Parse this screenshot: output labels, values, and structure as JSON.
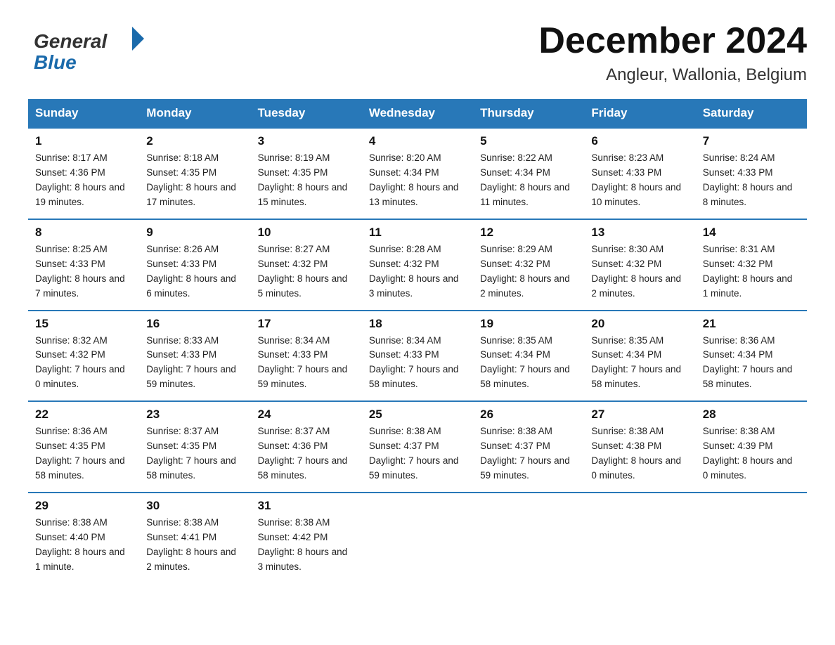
{
  "header": {
    "month_title": "December 2024",
    "location": "Angleur, Wallonia, Belgium",
    "logo_general": "General",
    "logo_blue": "Blue"
  },
  "weekdays": [
    "Sunday",
    "Monday",
    "Tuesday",
    "Wednesday",
    "Thursday",
    "Friday",
    "Saturday"
  ],
  "weeks": [
    [
      {
        "day": "1",
        "sunrise": "8:17 AM",
        "sunset": "4:36 PM",
        "daylight": "8 hours and 19 minutes."
      },
      {
        "day": "2",
        "sunrise": "8:18 AM",
        "sunset": "4:35 PM",
        "daylight": "8 hours and 17 minutes."
      },
      {
        "day": "3",
        "sunrise": "8:19 AM",
        "sunset": "4:35 PM",
        "daylight": "8 hours and 15 minutes."
      },
      {
        "day": "4",
        "sunrise": "8:20 AM",
        "sunset": "4:34 PM",
        "daylight": "8 hours and 13 minutes."
      },
      {
        "day": "5",
        "sunrise": "8:22 AM",
        "sunset": "4:34 PM",
        "daylight": "8 hours and 11 minutes."
      },
      {
        "day": "6",
        "sunrise": "8:23 AM",
        "sunset": "4:33 PM",
        "daylight": "8 hours and 10 minutes."
      },
      {
        "day": "7",
        "sunrise": "8:24 AM",
        "sunset": "4:33 PM",
        "daylight": "8 hours and 8 minutes."
      }
    ],
    [
      {
        "day": "8",
        "sunrise": "8:25 AM",
        "sunset": "4:33 PM",
        "daylight": "8 hours and 7 minutes."
      },
      {
        "day": "9",
        "sunrise": "8:26 AM",
        "sunset": "4:33 PM",
        "daylight": "8 hours and 6 minutes."
      },
      {
        "day": "10",
        "sunrise": "8:27 AM",
        "sunset": "4:32 PM",
        "daylight": "8 hours and 5 minutes."
      },
      {
        "day": "11",
        "sunrise": "8:28 AM",
        "sunset": "4:32 PM",
        "daylight": "8 hours and 3 minutes."
      },
      {
        "day": "12",
        "sunrise": "8:29 AM",
        "sunset": "4:32 PM",
        "daylight": "8 hours and 2 minutes."
      },
      {
        "day": "13",
        "sunrise": "8:30 AM",
        "sunset": "4:32 PM",
        "daylight": "8 hours and 2 minutes."
      },
      {
        "day": "14",
        "sunrise": "8:31 AM",
        "sunset": "4:32 PM",
        "daylight": "8 hours and 1 minute."
      }
    ],
    [
      {
        "day": "15",
        "sunrise": "8:32 AM",
        "sunset": "4:32 PM",
        "daylight": "7 hours and 0 minutes."
      },
      {
        "day": "16",
        "sunrise": "8:33 AM",
        "sunset": "4:33 PM",
        "daylight": "7 hours and 59 minutes."
      },
      {
        "day": "17",
        "sunrise": "8:34 AM",
        "sunset": "4:33 PM",
        "daylight": "7 hours and 59 minutes."
      },
      {
        "day": "18",
        "sunrise": "8:34 AM",
        "sunset": "4:33 PM",
        "daylight": "7 hours and 58 minutes."
      },
      {
        "day": "19",
        "sunrise": "8:35 AM",
        "sunset": "4:34 PM",
        "daylight": "7 hours and 58 minutes."
      },
      {
        "day": "20",
        "sunrise": "8:35 AM",
        "sunset": "4:34 PM",
        "daylight": "7 hours and 58 minutes."
      },
      {
        "day": "21",
        "sunrise": "8:36 AM",
        "sunset": "4:34 PM",
        "daylight": "7 hours and 58 minutes."
      }
    ],
    [
      {
        "day": "22",
        "sunrise": "8:36 AM",
        "sunset": "4:35 PM",
        "daylight": "7 hours and 58 minutes."
      },
      {
        "day": "23",
        "sunrise": "8:37 AM",
        "sunset": "4:35 PM",
        "daylight": "7 hours and 58 minutes."
      },
      {
        "day": "24",
        "sunrise": "8:37 AM",
        "sunset": "4:36 PM",
        "daylight": "7 hours and 58 minutes."
      },
      {
        "day": "25",
        "sunrise": "8:38 AM",
        "sunset": "4:37 PM",
        "daylight": "7 hours and 59 minutes."
      },
      {
        "day": "26",
        "sunrise": "8:38 AM",
        "sunset": "4:37 PM",
        "daylight": "7 hours and 59 minutes."
      },
      {
        "day": "27",
        "sunrise": "8:38 AM",
        "sunset": "4:38 PM",
        "daylight": "8 hours and 0 minutes."
      },
      {
        "day": "28",
        "sunrise": "8:38 AM",
        "sunset": "4:39 PM",
        "daylight": "8 hours and 0 minutes."
      }
    ],
    [
      {
        "day": "29",
        "sunrise": "8:38 AM",
        "sunset": "4:40 PM",
        "daylight": "8 hours and 1 minute."
      },
      {
        "day": "30",
        "sunrise": "8:38 AM",
        "sunset": "4:41 PM",
        "daylight": "8 hours and 2 minutes."
      },
      {
        "day": "31",
        "sunrise": "8:38 AM",
        "sunset": "4:42 PM",
        "daylight": "8 hours and 3 minutes."
      },
      null,
      null,
      null,
      null
    ]
  ]
}
